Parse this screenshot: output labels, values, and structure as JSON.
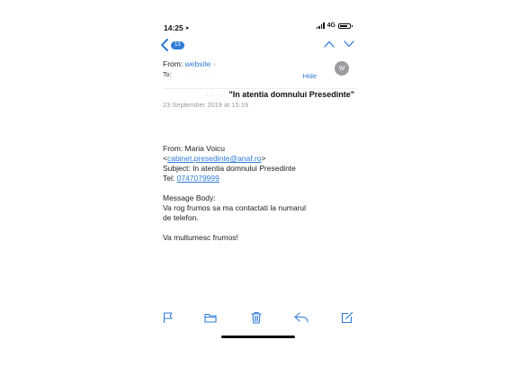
{
  "status": {
    "time": "14:25",
    "network": "4G",
    "battery_level": 0.75
  },
  "nav": {
    "unread_count": "13"
  },
  "message": {
    "from_label": "From:",
    "from_name": "website",
    "to_label": "To:",
    "to_value": "· · · · · · · ·",
    "hide_label": "Hide",
    "avatar_initial": "W",
    "subject_redacted": "· · · ·",
    "subject": "\"In atentia domnului Presedinte\"",
    "date": "23 September 2019 at 15:19"
  },
  "body": {
    "line_from": "From: Maria Voicu",
    "email_open": "<",
    "email": "cabinet.presedinte@anaf.ro",
    "email_close": ">",
    "line_subject": "Subject: In atentia domnului Presedinte",
    "tel_label": "Tel: ",
    "tel": "0747079999",
    "message_label": "Message Body:",
    "message_line1": "Va rog frumos sa ma contactati la numarul",
    "message_line2": "de telefon.",
    "closing": "Va multumesc frumos!"
  },
  "colors": {
    "accent": "#2f7bd9",
    "avatar": "#9b9ba0",
    "date": "#9a9a9a"
  },
  "icons": {
    "back": "chevron-left-icon",
    "prev": "chevron-up-icon",
    "next": "chevron-down-icon",
    "flag": "flag-icon",
    "folder": "folder-icon",
    "trash": "trash-icon",
    "reply": "reply-icon",
    "compose": "compose-icon"
  }
}
